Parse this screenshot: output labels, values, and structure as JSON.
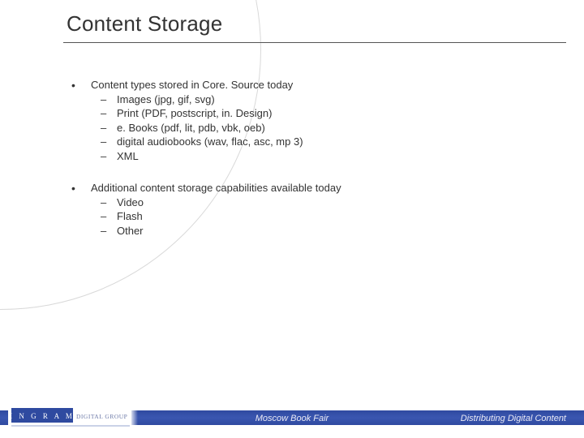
{
  "title": "Content Storage",
  "bullets": [
    {
      "label": "Content types stored in Core. Source today",
      "items": [
        "Images (jpg, gif, svg)",
        "Print (PDF, postscript, in. Design)",
        "e. Books (pdf, lit, pdb, vbk, oeb)",
        "digital audiobooks (wav, flac, asc, mp 3)",
        "XML"
      ]
    },
    {
      "label": "Additional content storage capabilities available today",
      "items": [
        "Video",
        "Flash",
        "Other"
      ]
    }
  ],
  "footer": {
    "center": "Moscow Book Fair",
    "right": "Distributing Digital Content"
  },
  "logo": {
    "letters": "I N G R A M",
    "sub": "DIGITAL GROUP"
  }
}
